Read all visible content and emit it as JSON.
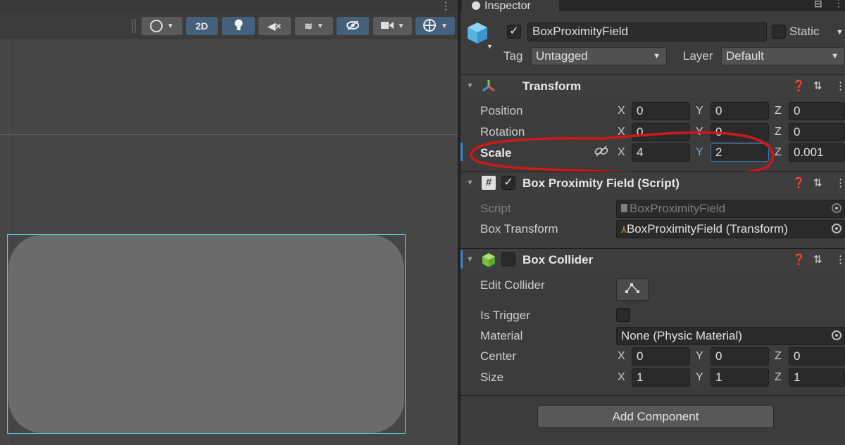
{
  "inspector": {
    "tab_label": "Inspector"
  },
  "object": {
    "name": "BoxProximityField",
    "static_label": "Static",
    "tag_label": "Tag",
    "tag_value": "Untagged",
    "layer_label": "Layer",
    "layer_value": "Default"
  },
  "toolbar": {
    "mode_2d": "2D"
  },
  "transform": {
    "title": "Transform",
    "position": {
      "label": "Position",
      "x": "0",
      "y": "0",
      "z": "0"
    },
    "rotation": {
      "label": "Rotation",
      "x": "0",
      "y": "0",
      "z": "0"
    },
    "scale": {
      "label": "Scale",
      "x": "4",
      "y": "2",
      "z": "0.001"
    },
    "axes": {
      "x": "X",
      "y": "Y",
      "z": "Z"
    }
  },
  "proximity": {
    "title": "Box Proximity Field (Script)",
    "script_label": "Script",
    "script_value": "BoxProximityField",
    "box_transform_label": "Box Transform",
    "box_transform_value": "BoxProximityField (Transform)"
  },
  "collider": {
    "title": "Box Collider",
    "edit_label": "Edit Collider",
    "trigger_label": "Is Trigger",
    "material_label": "Material",
    "material_value": "None (Physic Material)",
    "center": {
      "label": "Center",
      "x": "0",
      "y": "0",
      "z": "0"
    },
    "size": {
      "label": "Size",
      "x": "1",
      "y": "1",
      "z": "1"
    }
  },
  "add_component_label": "Add Component",
  "colors": {
    "accent": "#3a79bb",
    "selection_outline": "#58d0d6",
    "annotation": "#d01818"
  },
  "icons": [
    "info-icon",
    "cube-icon",
    "transform-icon",
    "script-icon",
    "box-collider-icon",
    "help-icon",
    "preset-icon",
    "more-icon",
    "link-icon",
    "target-icon"
  ]
}
